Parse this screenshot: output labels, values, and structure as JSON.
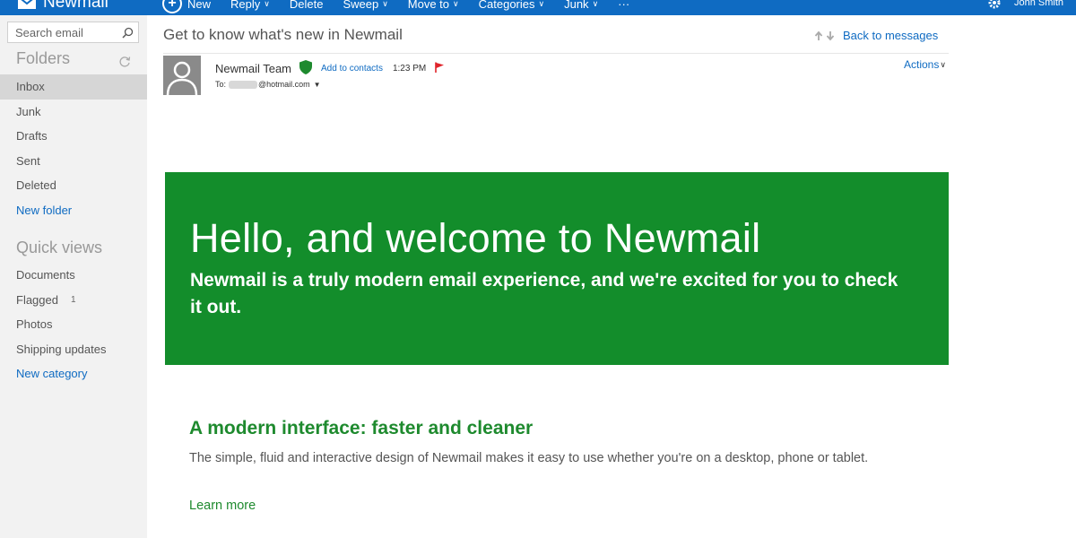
{
  "app": {
    "name": "Newmail",
    "user_name": "John Smith"
  },
  "commands": [
    {
      "label": "New",
      "icon": "plus-circle-icon"
    },
    {
      "label": "Reply",
      "has_menu": true
    },
    {
      "label": "Delete"
    },
    {
      "label": "Sweep",
      "has_menu": true
    },
    {
      "label": "Move to",
      "has_menu": true
    },
    {
      "label": "Categories",
      "has_menu": true
    },
    {
      "label": "Junk",
      "has_menu": true
    },
    {
      "label": "···"
    }
  ],
  "search": {
    "placeholder": "Search email"
  },
  "sidebar": {
    "folders_heading": "Folders",
    "folders": [
      {
        "label": "Inbox",
        "active": true
      },
      {
        "label": "Junk"
      },
      {
        "label": "Drafts"
      },
      {
        "label": "Sent"
      },
      {
        "label": "Deleted"
      }
    ],
    "new_folder": "New folder",
    "quick_views_heading": "Quick views",
    "quick_views": [
      {
        "label": "Documents"
      },
      {
        "label": "Flagged",
        "count": "1"
      },
      {
        "label": "Photos"
      },
      {
        "label": "Shipping updates"
      }
    ],
    "new_category": "New category"
  },
  "message": {
    "subject": "Get to know what's new in Newmail",
    "back_to_messages": "Back to messages",
    "sender": "Newmail Team",
    "add_to_contacts": "Add to contacts",
    "time": "1:23 PM",
    "to_label": "To:",
    "to_domain": "@hotmail.com",
    "actions_label": "Actions",
    "hero_title": "Hello, and welcome to Newmail",
    "hero_subtitle": "Newmail is a truly modern email experience, and we're excited for you to check it out.",
    "feature_title": "A modern interface: faster and cleaner",
    "feature_body": "The simple, fluid and interactive design of Newmail makes it easy to use whether you're on a desktop, phone or tablet.",
    "learn_more": "Learn more"
  },
  "colors": {
    "accent_blue": "#0f6bc2",
    "hero_green": "#138d2b",
    "heading_green": "#1e8a2e",
    "flag_red": "#e0242b"
  }
}
